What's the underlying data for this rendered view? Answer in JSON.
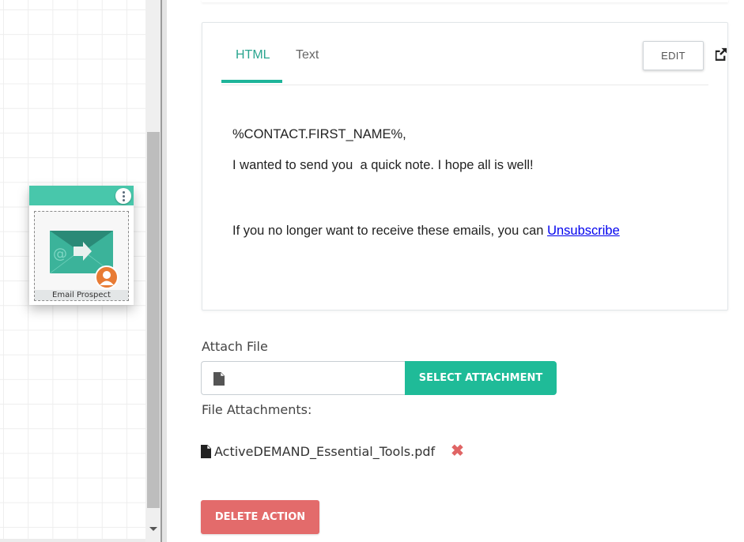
{
  "canvas": {
    "node": {
      "label": "Email Prospect",
      "icon": "email-send-icon",
      "badge_icon": "contact-avatar-icon",
      "menu_icon": "more-vertical-icon",
      "header_color": "#48c7ab"
    }
  },
  "editor": {
    "tabs": [
      {
        "label": "HTML",
        "active": true
      },
      {
        "label": "Text",
        "active": false
      }
    ],
    "edit_label": "EDIT",
    "external_icon": "external-link-icon",
    "body": {
      "line1": "%CONTACT.FIRST_NAME%,",
      "line2": "I wanted to send you  a quick note. I hope all is well!",
      "line3_prefix": "If you no longer want to receive these emails, you can ",
      "unsubscribe_link": "Unsubscribe"
    }
  },
  "attachments": {
    "attach_label": "Attach File",
    "input_value": "",
    "select_button": "SELECT ATTACHMENT",
    "files_label": "File Attachments:",
    "files": [
      {
        "name": "ActiveDEMAND_Essential_Tools.pdf"
      }
    ],
    "remove_icon": "✖"
  },
  "actions": {
    "delete_label": "DELETE ACTION"
  },
  "colors": {
    "accent": "#1fbb98",
    "danger": "#e36b6b",
    "link": "#0000ee"
  }
}
